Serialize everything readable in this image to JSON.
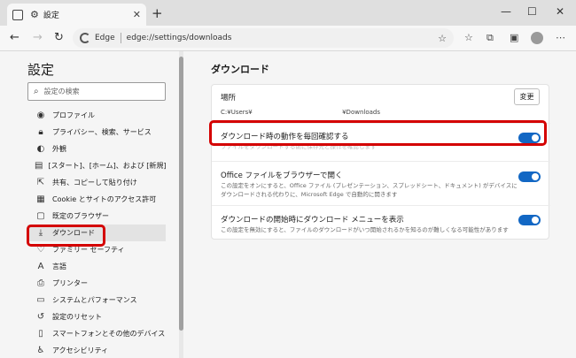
{
  "tab": {
    "title": "設定"
  },
  "address": {
    "brand": "Edge",
    "url": "edge://settings/downloads"
  },
  "sidebar": {
    "title": "設定",
    "search_placeholder": "設定の検索",
    "items": [
      {
        "label": "プロファイル",
        "icon": "profile-icon"
      },
      {
        "label": "プライバシー、検索、サービス",
        "icon": "lock-icon"
      },
      {
        "label": "外観",
        "icon": "appearance-icon"
      },
      {
        "label": "[スタート]、[ホーム]、および [新規] タブ",
        "icon": "start-home-icon"
      },
      {
        "label": "共有、コピーして貼り付け",
        "icon": "share-icon"
      },
      {
        "label": "Cookie とサイトのアクセス許可",
        "icon": "site-permissions-icon"
      },
      {
        "label": "既定のブラウザー",
        "icon": "default-browser-icon"
      },
      {
        "label": "ダウンロード",
        "icon": "download-icon"
      },
      {
        "label": "ファミリー セーフティ",
        "icon": "family-icon"
      },
      {
        "label": "言語",
        "icon": "language-icon"
      },
      {
        "label": "プリンター",
        "icon": "printer-icon"
      },
      {
        "label": "システムとパフォーマンス",
        "icon": "system-icon"
      },
      {
        "label": "設定のリセット",
        "icon": "reset-icon"
      },
      {
        "label": "スマートフォンとその他のデバイス",
        "icon": "phone-icon"
      },
      {
        "label": "アクセシビリティ",
        "icon": "accessibility-icon"
      }
    ]
  },
  "main": {
    "title": "ダウンロード",
    "location": {
      "label": "場所",
      "path_start": "C:¥Users¥",
      "path_end": "¥Downloads",
      "change_label": "変更"
    },
    "ask_each_time": {
      "label": "ダウンロード時の動作を毎回確認する",
      "desc": "ファイルをダウンロードする前に保存先と操作を確認します",
      "enabled": true
    },
    "open_office": {
      "label": "Office ファイルをブラウザーで開く",
      "desc": "この設定をオンにすると、Office ファイル (プレゼンテーション、スプレッドシート、ドキュメント) がデバイスにダウンロードされる代わりに、Microsoft Edge で自動的に開きます",
      "enabled": true
    },
    "show_menu": {
      "label": "ダウンロードの開始時にダウンロード メニューを表示",
      "desc": "この設定を無効にすると、ファイルのダウンロードがいつ開始されるかを知るのが難しくなる可能性があります",
      "enabled": true
    }
  },
  "colors": {
    "accent": "#1267c4",
    "highlight": "#d40000"
  }
}
